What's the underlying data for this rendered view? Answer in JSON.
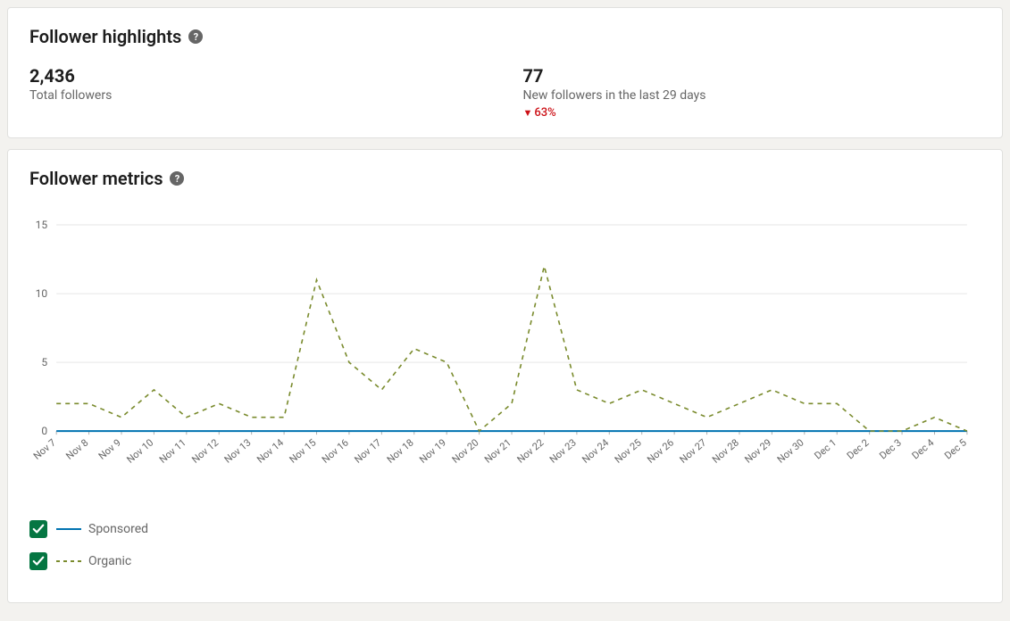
{
  "highlights": {
    "title": "Follower highlights",
    "total_followers_value": "2,436",
    "total_followers_label": "Total followers",
    "new_followers_value": "77",
    "new_followers_label": "New followers in the last 29 days",
    "delta_text": "63%",
    "delta_direction": "down"
  },
  "metrics": {
    "title": "Follower metrics",
    "legend": {
      "sponsored": "Sponsored",
      "organic": "Organic"
    }
  },
  "chart_data": {
    "type": "line",
    "title": "Follower metrics",
    "xlabel": "",
    "ylabel": "",
    "ylim": [
      0,
      15
    ],
    "y_ticks": [
      0,
      5,
      10,
      15
    ],
    "categories": [
      "Nov 7",
      "Nov 8",
      "Nov 9",
      "Nov 10",
      "Nov 11",
      "Nov 12",
      "Nov 13",
      "Nov 14",
      "Nov 15",
      "Nov 16",
      "Nov 17",
      "Nov 18",
      "Nov 19",
      "Nov 20",
      "Nov 21",
      "Nov 22",
      "Nov 23",
      "Nov 24",
      "Nov 25",
      "Nov 26",
      "Nov 27",
      "Nov 28",
      "Nov 29",
      "Nov 30",
      "Dec 1",
      "Dec 2",
      "Dec 3",
      "Dec 4",
      "Dec 5"
    ],
    "series": [
      {
        "name": "Sponsored",
        "values": [
          0,
          0,
          0,
          0,
          0,
          0,
          0,
          0,
          0,
          0,
          0,
          0,
          0,
          0,
          0,
          0,
          0,
          0,
          0,
          0,
          0,
          0,
          0,
          0,
          0,
          0,
          0,
          0,
          0
        ],
        "style": "solid",
        "color": "#0073b1"
      },
      {
        "name": "Organic",
        "values": [
          2,
          2,
          1,
          3,
          1,
          2,
          1,
          1,
          11,
          5,
          3,
          6,
          5,
          0,
          2,
          12,
          3,
          2,
          3,
          2,
          1,
          2,
          3,
          2,
          2,
          0,
          0,
          1,
          0
        ],
        "style": "dashed",
        "color": "#7a8b2d"
      }
    ]
  }
}
